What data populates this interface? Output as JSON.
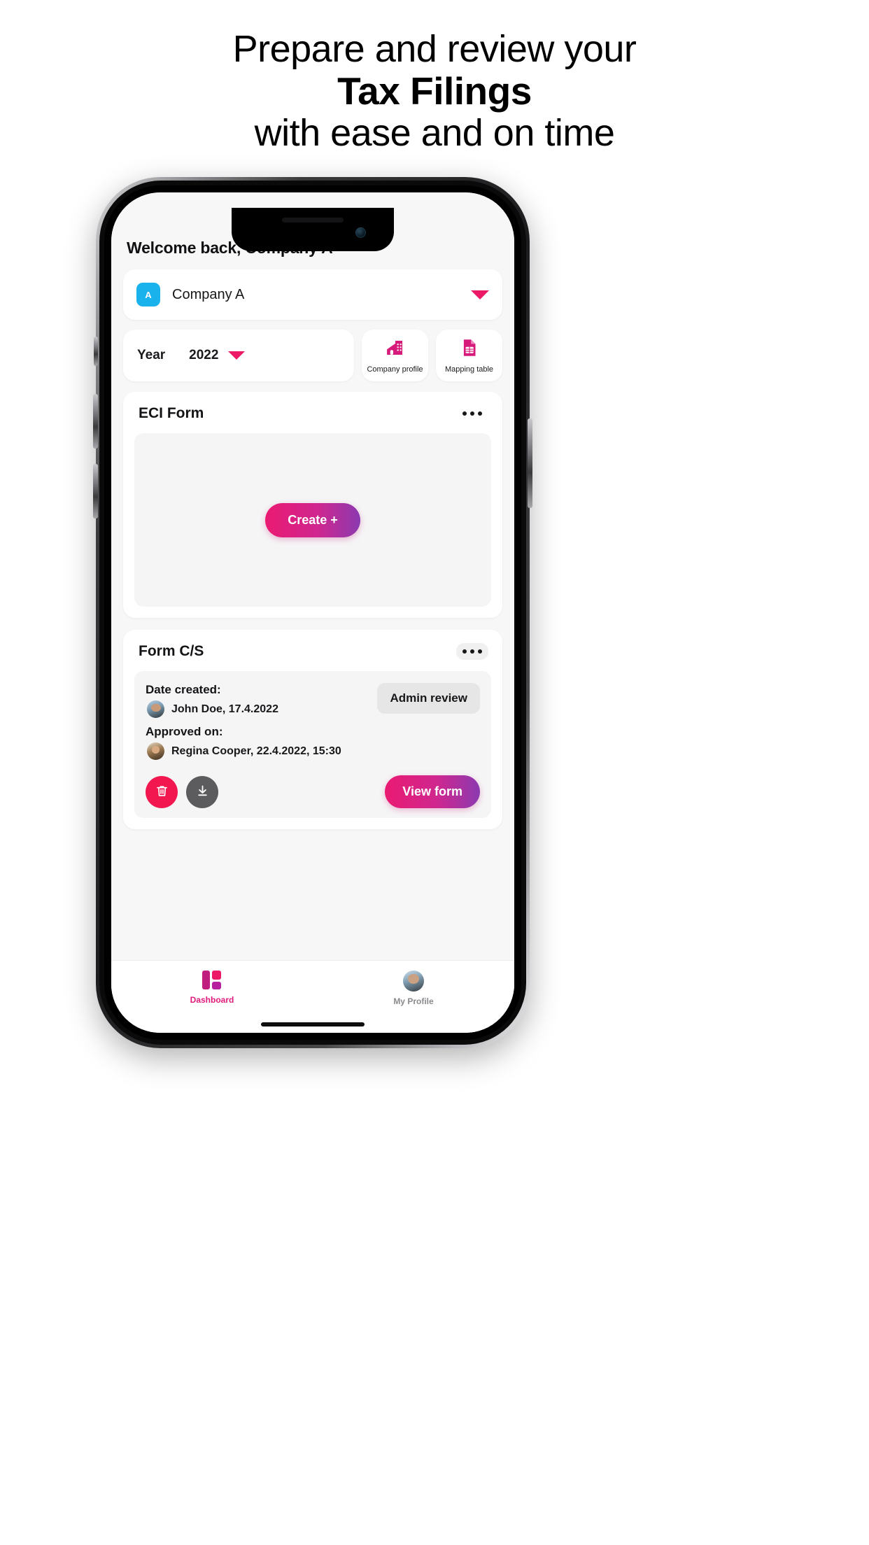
{
  "headline": {
    "line1": "Prepare and review your",
    "line2": "Tax Filings",
    "line3": "with ease and on time"
  },
  "colors": {
    "accent_pink": "#ec1a66",
    "accent_magenta": "#ea1a72",
    "accent_purple": "#8a3ab0",
    "avatar_blue": "#19b2ec",
    "delete_red": "#f2184f",
    "download_gray": "#5c5c5e",
    "screen_bg": "#f7f7f8"
  },
  "app": {
    "welcome": "Welcome back, Company A",
    "company_selector": {
      "avatar_initial": "A",
      "name": "Company A",
      "caret_icon": "chevron-down-icon"
    },
    "year_selector": {
      "label": "Year",
      "value": "2022",
      "caret_icon": "chevron-down-icon"
    },
    "tools": [
      {
        "label": "Company profile",
        "icon": "building-icon"
      },
      {
        "label": "Mapping table",
        "icon": "table-document-icon"
      }
    ],
    "eci": {
      "title": "ECI Form",
      "menu_icon": "more-horizontal-icon",
      "create_label": "Create +"
    },
    "form_cs": {
      "title": "Form C/S",
      "menu_icon": "more-horizontal-icon",
      "status": "Admin review",
      "created": {
        "label": "Date created:",
        "person": "John Doe, 17.4.2022",
        "avatar": "avatar-john"
      },
      "approved": {
        "label": "Approved on:",
        "person": "Regina Cooper, 22.4.2022, 15:30",
        "avatar": "avatar-regina"
      },
      "actions": {
        "delete_icon": "trash-icon",
        "download_icon": "download-icon",
        "view_label": "View form"
      }
    },
    "tabs": [
      {
        "label": "Dashboard",
        "icon": "dashboard-icon",
        "active": true
      },
      {
        "label": "My Profile",
        "icon": "avatar-icon",
        "active": false
      }
    ]
  }
}
